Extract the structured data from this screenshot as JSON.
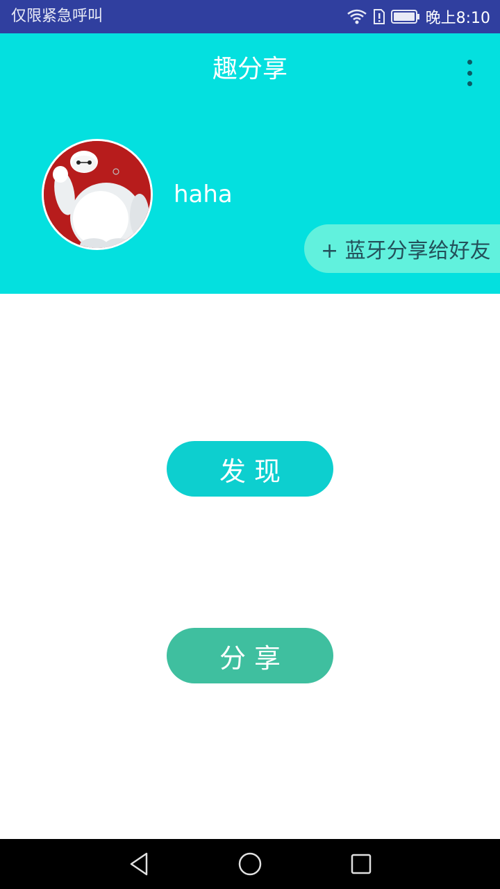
{
  "status_bar": {
    "carrier_text": "仅限紧急呼叫",
    "time": "晚上8:10",
    "icons": [
      "wifi-icon",
      "sim-alert-icon",
      "battery-icon"
    ]
  },
  "toolbar": {
    "title": "趣分享",
    "menu_icon": "overflow-menu-icon"
  },
  "profile": {
    "username": "haha",
    "avatar_icon": "baymax-avatar"
  },
  "actions": {
    "bluetooth_share_label": "+ 蓝牙分享给好友",
    "discover_label": "发现",
    "share_label": "分享"
  },
  "nav_bar": {
    "icons": [
      "back-icon",
      "home-icon",
      "recents-icon"
    ]
  },
  "colors": {
    "status_bar": "#303f9f",
    "header": "#04e0df",
    "bluetooth_button": "#61f1dd",
    "discover_button": "#0dcfcf",
    "share_button": "#3fbf9f",
    "nav_bar": "#000000"
  }
}
